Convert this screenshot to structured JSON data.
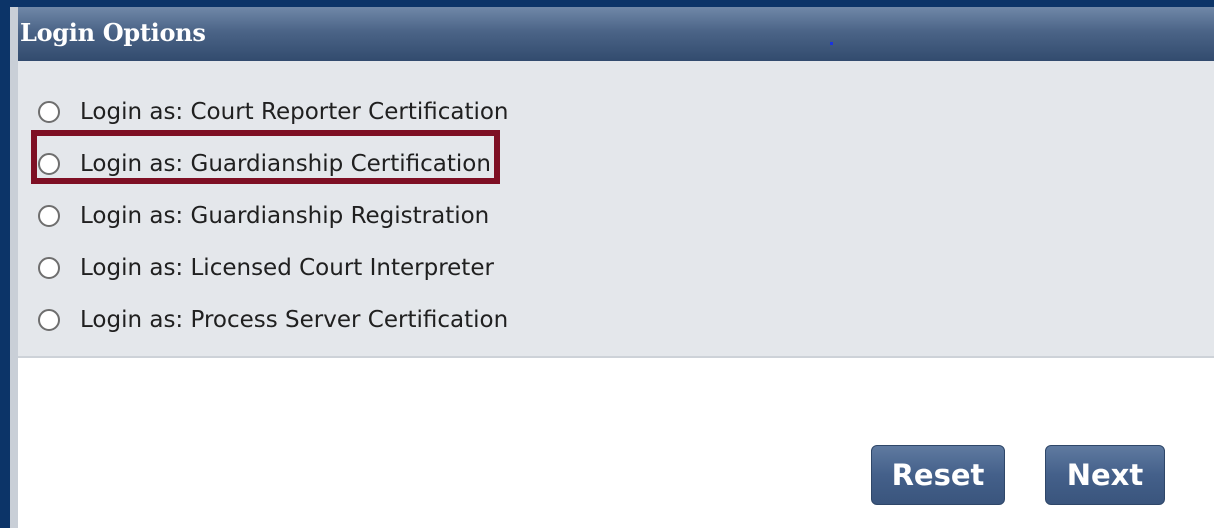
{
  "panel": {
    "title": "Login Options"
  },
  "options": [
    {
      "label": "Login as: Court Reporter Certification",
      "selected": false
    },
    {
      "label": "Login as: Guardianship Certification",
      "selected": false
    },
    {
      "label": "Login as: Guardianship Registration",
      "selected": false,
      "highlighted": true
    },
    {
      "label": "Login as: Licensed Court Interpreter",
      "selected": false
    },
    {
      "label": "Login as: Process Server Certification",
      "selected": false
    }
  ],
  "buttons": {
    "reset_label": "Reset",
    "next_label": "Next"
  },
  "colors": {
    "frame": "#0c3468",
    "header": "#4b6487",
    "options_bg": "#e4e7eb",
    "highlight": "#7e0f24",
    "button": "#44608a"
  }
}
